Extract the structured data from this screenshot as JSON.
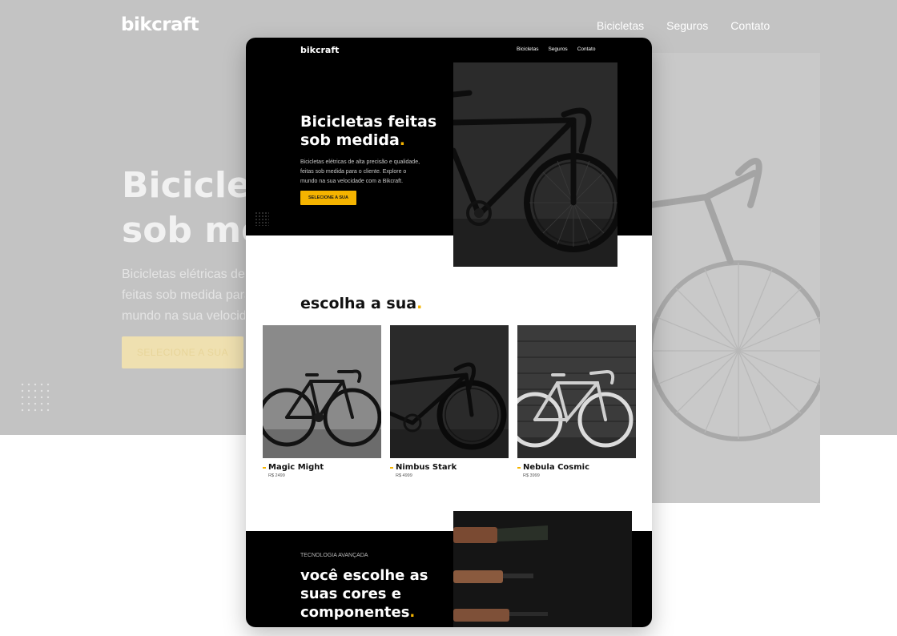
{
  "background": {
    "logo": "bikcraft",
    "nav": [
      "Bicicletas",
      "Seguros",
      "Contato"
    ],
    "hero_title_lines": [
      "Bicicletas feitas",
      "sob medida."
    ],
    "hero_text_lines": [
      "Bicicletas elétricas de alta precisão e qualidade,",
      "feitas sob medida para o cliente. Explore o",
      "mundo na sua velocidade com a Bikcraft."
    ],
    "cta_label": "SELECIONE A SUA"
  },
  "card": {
    "logo": "bikcraft",
    "nav": [
      "Bicicletas",
      "Seguros",
      "Contato"
    ],
    "hero": {
      "title_line1": "Bicicletas feitas",
      "title_line2": "sob medida",
      "title_dot": ".",
      "text": "Bicicletas elétricas de alta precisão e qualidade, feitas sob medida para o cliente. Explore o mundo na sua velocidade com a Bikcraft.",
      "cta_label": "SELECIONE A SUA"
    },
    "products_section": {
      "title": "escolha a sua",
      "title_dot": ".",
      "items": [
        {
          "name": "Magic Might",
          "price": "R$ 2499"
        },
        {
          "name": "Nimbus Stark",
          "price": "R$ 4999"
        },
        {
          "name": "Nebula Cosmic",
          "price": "R$ 3999"
        }
      ]
    },
    "technology": {
      "subtitle": "TECNOLOGIA AVANÇADA",
      "title_line1": "você escolhe as",
      "title_line2": "suas cores e",
      "title_line3": "componentes",
      "title_dot": "."
    }
  },
  "colors": {
    "accent": "#f5b400",
    "dark": "#000000",
    "background_grey": "#c3c3c3"
  }
}
